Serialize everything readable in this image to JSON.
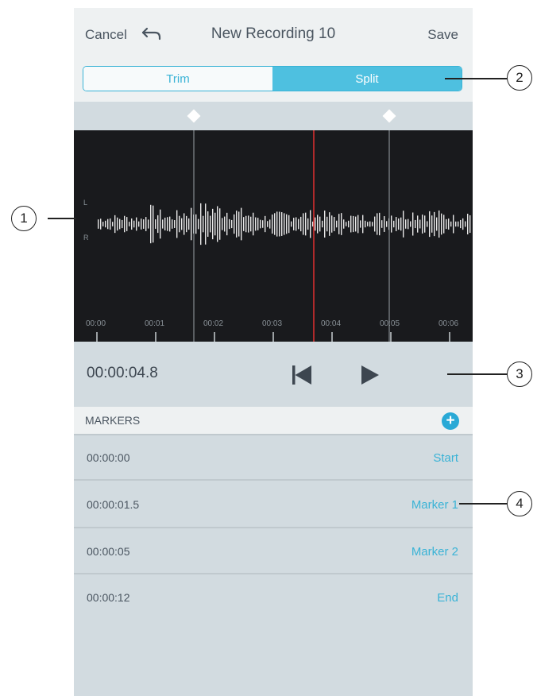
{
  "header": {
    "cancel_label": "Cancel",
    "title": "New Recording 10",
    "save_label": "Save"
  },
  "segments": {
    "trim_label": "Trim",
    "split_label": "Split",
    "selected": "Split"
  },
  "waveform": {
    "channel_top": "L",
    "channel_bottom": "R",
    "ticks": [
      "00:00",
      "00:01",
      "00:02",
      "00:03",
      "00:04",
      "00:05",
      "00:06"
    ],
    "playhead_color": "#e03030"
  },
  "transport": {
    "time": "00:00:04.8"
  },
  "markers": {
    "heading": "MARKERS",
    "add_icon": "+",
    "items": [
      {
        "time": "00:00:00",
        "name": "Start"
      },
      {
        "time": "00:00:01.5",
        "name": "Marker 1"
      },
      {
        "time": "00:00:05",
        "name": "Marker 2"
      },
      {
        "time": "00:00:12",
        "name": "End"
      }
    ]
  },
  "callouts": [
    "1",
    "2",
    "3",
    "4"
  ]
}
